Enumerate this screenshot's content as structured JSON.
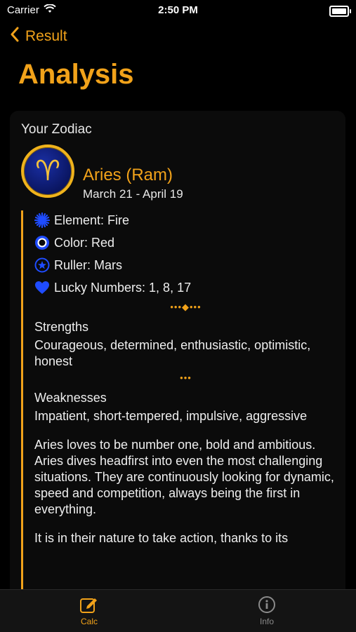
{
  "status": {
    "carrier": "Carrier",
    "time": "2:50 PM"
  },
  "nav": {
    "back_label": "Result",
    "title": "Analysis"
  },
  "card": {
    "heading": "Your Zodiac",
    "sign_symbol": "♈",
    "sign_name": "Aries (Ram)",
    "sign_dates": "March 21 - April 19",
    "properties": [
      {
        "icon": "sparkle-icon",
        "label": "Element: Fire"
      },
      {
        "icon": "circle-icon",
        "label": "Color: Red"
      },
      {
        "icon": "star-circle-icon",
        "label": "Ruller: Mars"
      },
      {
        "icon": "heart-icon",
        "label": "Lucky Numbers: 1, 8, 17"
      }
    ],
    "divider_main": "•••◆•••",
    "divider_small": "•••",
    "strengths_title": "Strengths",
    "strengths_text": "Courageous, determined, enthusiastic, optimistic, honest",
    "weaknesses_title": "Weaknesses",
    "weaknesses_text": "Impatient, short-tempered, impulsive, aggressive",
    "paragraph_1": "Aries loves to be number one, bold and ambitious. Aries dives headfirst into even the most challenging situations. They are continuously looking for dynamic, speed and competition, always being the first in everything.",
    "paragraph_2": "It is in their nature to take action, thanks to its"
  },
  "tabs": [
    {
      "label": "Calc",
      "icon": "edit-icon",
      "active": true
    },
    {
      "label": "Info",
      "icon": "info-icon",
      "active": false
    }
  ],
  "colors": {
    "accent": "#f1a21a",
    "icon_blue": "#1f4cff",
    "background": "#000000"
  }
}
